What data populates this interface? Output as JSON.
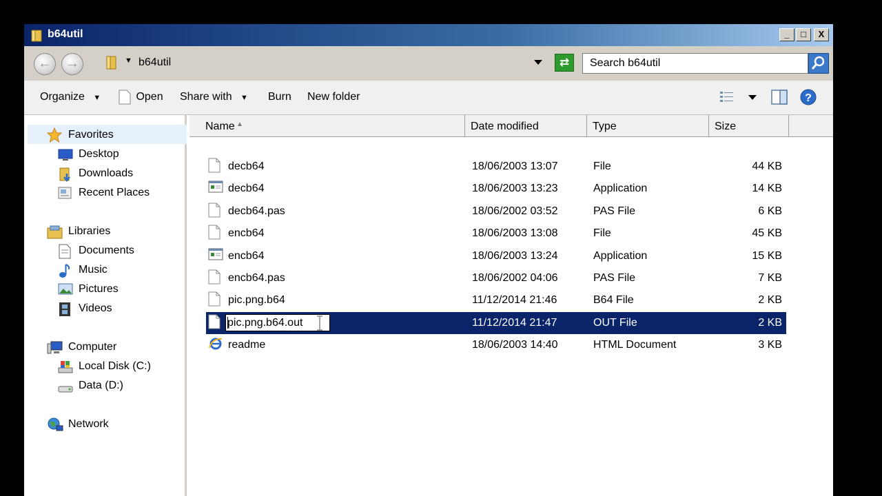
{
  "window": {
    "title": "b64util",
    "buttons": {
      "minimize": "_",
      "maximize": "□",
      "close": "X"
    }
  },
  "address": {
    "path": "b64util",
    "search_placeholder": "Search b64util"
  },
  "toolbar": {
    "organize": "Organize",
    "open": "Open",
    "share_with": "Share with",
    "burn": "Burn",
    "new_folder": "New folder"
  },
  "nav": {
    "favorites": "Favorites",
    "desktop": "Desktop",
    "downloads": "Downloads",
    "recent_places": "Recent Places",
    "libraries": "Libraries",
    "documents": "Documents",
    "music": "Music",
    "pictures": "Pictures",
    "videos": "Videos",
    "computer": "Computer",
    "local_disk": "Local Disk (C:)",
    "data_disk": "Data (D:)",
    "network": "Network"
  },
  "columns": {
    "name": "Name",
    "date_modified": "Date modified",
    "type": "Type",
    "size": "Size"
  },
  "files": [
    {
      "name": "decb64",
      "date": "18/06/2003 13:07",
      "type": "File",
      "size": "44 KB",
      "icon": "blank-file-icon"
    },
    {
      "name": "decb64",
      "date": "18/06/2003 13:23",
      "type": "Application",
      "size": "14 KB",
      "icon": "application-icon"
    },
    {
      "name": "decb64.pas",
      "date": "18/06/2002 03:52",
      "type": "PAS File",
      "size": "6 KB",
      "icon": "blank-file-icon"
    },
    {
      "name": "encb64",
      "date": "18/06/2003 13:08",
      "type": "File",
      "size": "45 KB",
      "icon": "blank-file-icon"
    },
    {
      "name": "encb64",
      "date": "18/06/2003 13:24",
      "type": "Application",
      "size": "15 KB",
      "icon": "application-icon"
    },
    {
      "name": "encb64.pas",
      "date": "18/06/2002 04:06",
      "type": "PAS File",
      "size": "7 KB",
      "icon": "blank-file-icon"
    },
    {
      "name": "pic.png.b64",
      "date": "11/12/2014 21:46",
      "type": "B64 File",
      "size": "2 KB",
      "icon": "blank-file-icon"
    },
    {
      "name": "pic.png.b64.out",
      "date": "11/12/2014 21:47",
      "type": "OUT File",
      "size": "2 KB",
      "icon": "blank-file-icon",
      "selected": true,
      "renaming": true
    },
    {
      "name": "readme",
      "date": "18/06/2003 14:40",
      "type": "HTML Document",
      "size": "3 KB",
      "icon": "internet-explorer-icon"
    }
  ],
  "colors": {
    "selection": "#0a246a",
    "titlebar": "#0a246a"
  }
}
